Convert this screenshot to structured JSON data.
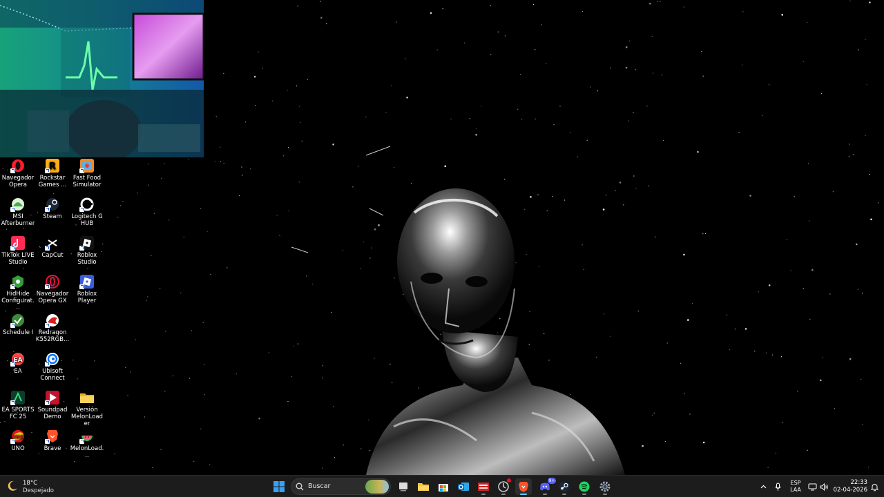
{
  "desktop": {
    "icons": [
      {
        "label": "Navegador Opera",
        "icon": "opera-icon"
      },
      {
        "label": "Rockstar Games ...",
        "icon": "rockstar-icon"
      },
      {
        "label": "Fast Food Simulator",
        "icon": "fast-food-icon"
      },
      {
        "label": "MSI Afterburner",
        "icon": "msi-icon"
      },
      {
        "label": "Steam",
        "icon": "steam-icon"
      },
      {
        "label": "Logitech G HUB",
        "icon": "logitech-icon"
      },
      {
        "label": "TikTok LIVE Studio",
        "icon": "tiktok-icon"
      },
      {
        "label": "CapCut",
        "icon": "capcut-icon"
      },
      {
        "label": "Roblox Studio",
        "icon": "roblox-studio-icon"
      },
      {
        "label": "HidHide Configurat...",
        "icon": "hidhide-icon"
      },
      {
        "label": "Navegador Opera GX",
        "icon": "opera-gx-icon"
      },
      {
        "label": "Roblox Player",
        "icon": "roblox-player-icon"
      },
      {
        "label": "Schedule I",
        "icon": "schedule-icon"
      },
      {
        "label": "Redragon K552RGB...",
        "icon": "redragon-icon"
      },
      {
        "label": "EA",
        "icon": "ea-icon"
      },
      {
        "label": "Ubisoft Connect",
        "icon": "ubisoft-icon"
      },
      {
        "label": "EA SPORTS FC 25",
        "icon": "fc25-icon"
      },
      {
        "label": "Soundpad Demo",
        "icon": "soundpad-icon"
      },
      {
        "label": "Versión MelonLoader",
        "icon": "folder-icon"
      },
      {
        "label": "UNO",
        "icon": "uno-icon"
      },
      {
        "label": "Brave",
        "icon": "brave-icon"
      },
      {
        "label": "MelonLoad...",
        "icon": "melonloader-icon"
      }
    ]
  },
  "taskbar": {
    "weather": {
      "temp": "18°C",
      "condition": "Despejado"
    },
    "search": {
      "placeholder": "Buscar"
    },
    "apps": [
      "start",
      "task-view",
      "file-explorer",
      "microsoft-store",
      "outlook",
      "news-app",
      "chrome-like",
      "brave",
      "discord",
      "steam",
      "spotify",
      "settings"
    ],
    "discord_badge": "9+",
    "tray": {
      "lang_top": "ESP",
      "lang_bottom": "LAA",
      "time": "22:33",
      "date": "02-04-2026"
    }
  },
  "colors": {
    "taskbar_bg": "#1c1c1c",
    "accent": "#0078d4"
  }
}
